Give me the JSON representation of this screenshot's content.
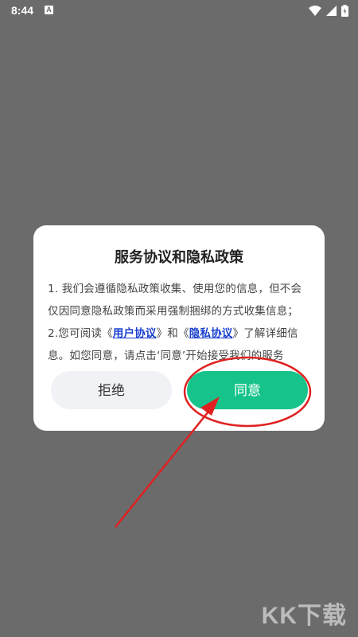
{
  "status_bar": {
    "time": "8:44",
    "notification_letter": "A"
  },
  "dialog": {
    "title": "服务协议和隐私政策",
    "line1": "1. 我们会遵循隐私政策收集、使用您的信息，但不会仅因同意隐私政策而采用强制捆绑的方式收集信息；",
    "line2_prefix": "2.您可阅读《",
    "user_agreement_link": "用户协议",
    "line2_mid": "》和《",
    "privacy_link": "隐私协议",
    "line2_suffix": "》了解详细信息。如您同意，请点击‘同意’开始接受我们的服务",
    "reject_label": "拒绝",
    "agree_label": "同意"
  },
  "colors": {
    "overlay": "#6b6b6b",
    "agree_button": "#16c48b",
    "reject_button": "#f1f2f6",
    "link": "#1a3fd0",
    "annotation": "#e02020"
  },
  "watermark": "KK下载"
}
